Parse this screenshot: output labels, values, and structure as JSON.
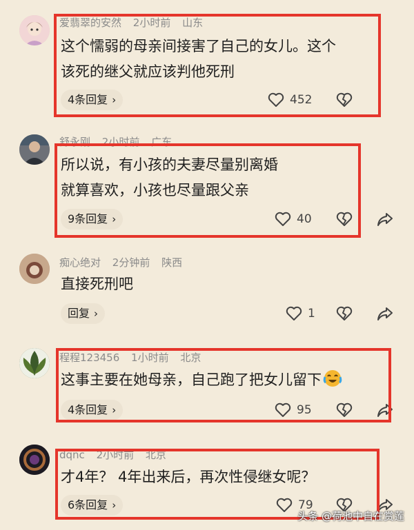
{
  "comments": [
    {
      "user": "爱翡翠的安然",
      "time": "2小时前",
      "location": "山东",
      "lines": [
        "这个懦弱的母亲间接害了自己的女儿。这个",
        "该死的继父就应该判他死刑"
      ],
      "reply_label": "4条回复",
      "likes": "452"
    },
    {
      "user": "舒永刚",
      "time": "2小时前",
      "location": "广东",
      "lines": [
        "所以说，有小孩的夫妻尽量别离婚",
        "就算喜欢，小孩也尽量跟父亲"
      ],
      "reply_label": "9条回复",
      "likes": "40"
    },
    {
      "user": "痴心绝对",
      "time": "2分钟前",
      "location": "陕西",
      "lines": [
        "直接死刑吧"
      ],
      "reply_label": "回复",
      "likes": "1"
    },
    {
      "user": "程程123456",
      "time": "1小时前",
      "location": "北京",
      "lines": [
        "这事主要在她母亲，自己跑了把女儿留下"
      ],
      "reply_label": "4条回复",
      "likes": "95"
    },
    {
      "user": "dqnc",
      "time": "2小时前",
      "location": "北京",
      "lines": [
        "才4年？ 4年出来后，再次性侵继女呢？"
      ],
      "reply_label": "6条回复",
      "likes": "79"
    }
  ],
  "watermark": "头条 @荷池中自在赏莲",
  "icons": {
    "like": "heart-outline-icon",
    "dislike": "broken-heart-icon",
    "share": "share-arrow-icon",
    "reply_chevron": "chevron-right-icon",
    "emoji": "crying-laughing-emoji-icon"
  },
  "colors": {
    "background": "#f3ebdb",
    "highlight_box": "#e5352b",
    "meta_text": "#8a8a8a"
  }
}
